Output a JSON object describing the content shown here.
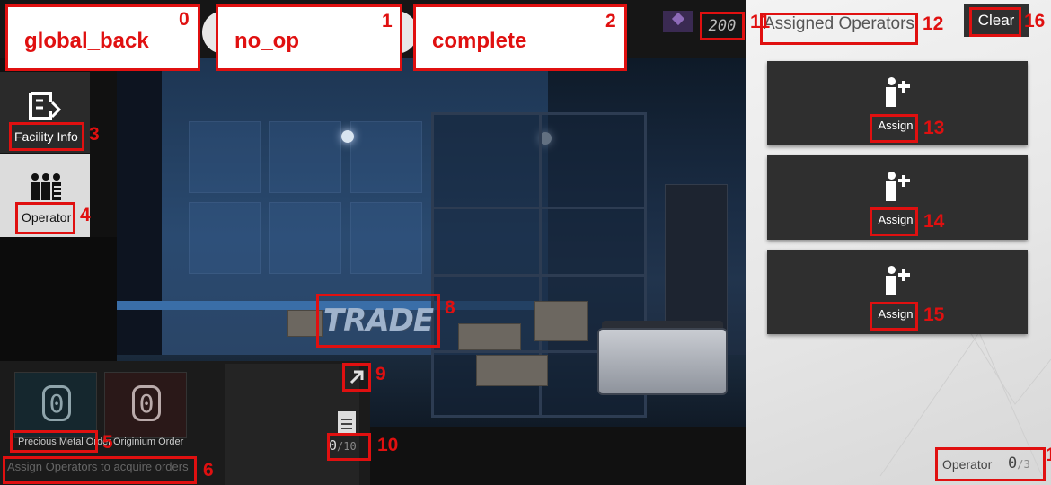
{
  "top_buttons": {
    "back_label": "global_back",
    "noop_label": "no_op",
    "complete_label": "complete"
  },
  "drone": {
    "icon": "drone-icon",
    "count": "200"
  },
  "sidebar": {
    "facility_info_label": "Facility Info",
    "operator_label": "Operator"
  },
  "orders": {
    "precious_metal": {
      "value": "0",
      "label": "Precious Metal Order"
    },
    "originium": {
      "value": "0",
      "label": "Originium Order"
    },
    "hint": "Assign Operators to acquire orders",
    "count_value": "0",
    "count_max": "/10"
  },
  "scene": {
    "sign_text": "TRADE"
  },
  "right_panel": {
    "title": "Assigned Operators",
    "clear_label": "Clear",
    "slots": [
      {
        "assign_label": "Assign"
      },
      {
        "assign_label": "Assign"
      },
      {
        "assign_label": "Assign"
      }
    ],
    "operator_label": "Operator",
    "operator_count": "0",
    "operator_max": "/3"
  },
  "annotations": [
    "0",
    "1",
    "2",
    "3",
    "4",
    "5",
    "6",
    "8",
    "9",
    "10",
    "11",
    "12",
    "13",
    "14",
    "15",
    "16",
    "1"
  ],
  "colors": {
    "annotation_red": "#e01010",
    "panel_dark": "#2f2f2f",
    "right_bg": "#eeeeee"
  }
}
